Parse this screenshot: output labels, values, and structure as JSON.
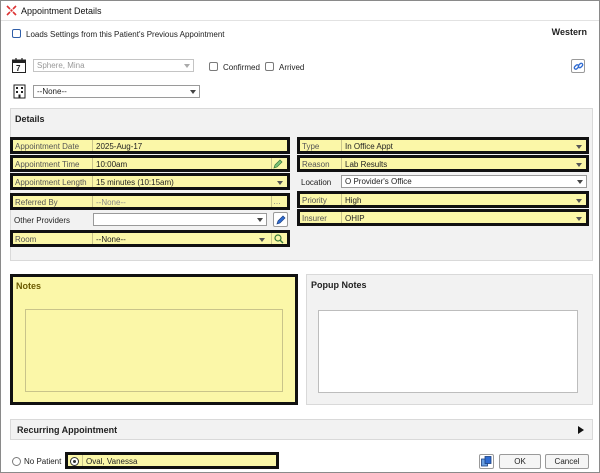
{
  "window": {
    "title": "Appointment Details"
  },
  "top": {
    "load_settings_label": "Loads Settings from this Patient's Previous Appointment",
    "site": "Western",
    "provider_value": "Sphere, Mina",
    "confirmed_label": "Confirmed",
    "arrived_label": "Arrived",
    "schedule_value": "--None--"
  },
  "details": {
    "title": "Details",
    "appointment_date": {
      "label": "Appointment Date",
      "value": "2025-Aug-17"
    },
    "appointment_time": {
      "label": "Appointment Time",
      "value": "10:00am"
    },
    "appointment_length": {
      "label": "Appointment Length",
      "value": "15 minutes (10:15am)"
    },
    "referred_by": {
      "label": "Referred By",
      "value": "--None--"
    },
    "other_providers": {
      "label": "Other Providers",
      "value": ""
    },
    "room": {
      "label": "Room",
      "value": "--None--"
    },
    "type": {
      "label": "Type",
      "value": "In Office Appt"
    },
    "reason": {
      "label": "Reason",
      "value": "Lab Results"
    },
    "location": {
      "label": "Location",
      "value": "O Provider's Office"
    },
    "priority": {
      "label": "Priority",
      "value": "High"
    },
    "insurer": {
      "label": "Insurer",
      "value": "OHIP"
    }
  },
  "notes": {
    "title": "Notes"
  },
  "popup_notes": {
    "title": "Popup Notes"
  },
  "recurring": {
    "title": "Recurring Appointment"
  },
  "footer": {
    "no_patient_label": "No Patient",
    "patient_value": "Oval, Vanessa",
    "ok_label": "OK",
    "cancel_label": "Cancel"
  }
}
